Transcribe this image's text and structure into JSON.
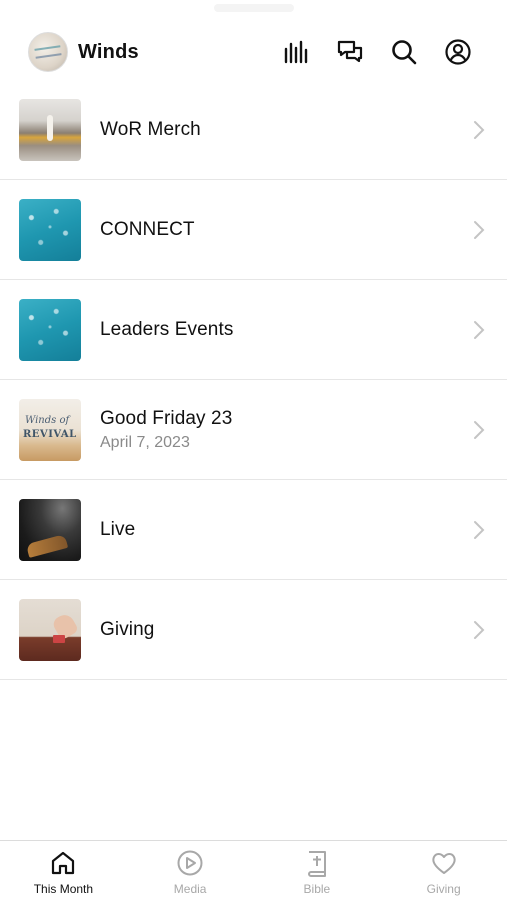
{
  "header": {
    "title": "Winds",
    "icons": [
      "equalizer-icon",
      "chat-icon",
      "search-icon",
      "profile-icon"
    ]
  },
  "items": [
    {
      "title": "WoR Merch",
      "subtitle": "",
      "thumb": "merch-photo"
    },
    {
      "title": "CONNECT",
      "subtitle": "",
      "thumb": "teal-bubbles"
    },
    {
      "title": "Leaders Events",
      "subtitle": "",
      "thumb": "teal-bubbles"
    },
    {
      "title": "Good Friday 23",
      "subtitle": "April 7, 2023",
      "thumb": "winds-of-revival-art",
      "thumb_text_1": "Winds of",
      "thumb_text_2": "REVIVAL"
    },
    {
      "title": "Live",
      "subtitle": "",
      "thumb": "worship-hands"
    },
    {
      "title": "Giving",
      "subtitle": "",
      "thumb": "offering-hand"
    }
  ],
  "tabs": [
    {
      "label": "This Month",
      "icon": "home-icon",
      "active": true
    },
    {
      "label": "Media",
      "icon": "play-icon",
      "active": false
    },
    {
      "label": "Bible",
      "icon": "bible-icon",
      "active": false
    },
    {
      "label": "Giving",
      "icon": "heart-icon",
      "active": false
    }
  ],
  "colors": {
    "text": "#111111",
    "muted": "#8a8a8a",
    "tab_inactive": "#a8a8a8",
    "divider": "#e6e6e6"
  }
}
